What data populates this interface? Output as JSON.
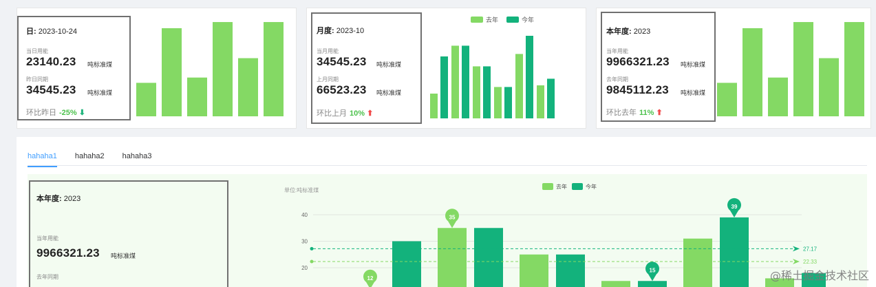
{
  "cards": [
    {
      "title_label": "日:",
      "title_value": "2023-10-24",
      "cur_label": "当日用能",
      "cur_value": "23140.23",
      "cur_unit": "吨标准煤",
      "prev_label": "昨日同期",
      "prev_value": "34545.23",
      "prev_unit": "吨标准煤",
      "compare_label": "环比昨日",
      "compare_value": "-25%",
      "arrow": "⬇",
      "bars": [
        0.38,
        1.0,
        0.44,
        1.07,
        0.66,
        1.07
      ]
    },
    {
      "title_label": "月度:",
      "title_value": "2023-10",
      "cur_label": "当月用能",
      "cur_value": "34545.23",
      "cur_unit": "吨标准煤",
      "prev_label": "上月同期",
      "prev_value": "66523.23",
      "prev_unit": "吨标准煤",
      "compare_label": "环比上月",
      "compare_value": "10%",
      "arrow": "⬆",
      "legend_last": "去年",
      "legend_this": "今年",
      "groups": [
        [
          0.3,
          0.75
        ],
        [
          0.88,
          0.88
        ],
        [
          0.63,
          0.63
        ],
        [
          0.38,
          0.38
        ],
        [
          0.78,
          1.0
        ],
        [
          0.4,
          0.48
        ]
      ]
    },
    {
      "title_label": "本年度:",
      "title_value": "2023",
      "cur_label": "当年用能",
      "cur_value": "9966321.23",
      "cur_unit": "吨标准煤",
      "prev_label": "去年同期",
      "prev_value": "9845112.23",
      "prev_unit": "吨标准煤",
      "compare_label": "环比去年",
      "compare_value": "11%",
      "arrow": "⬆",
      "bars": [
        0.38,
        1.0,
        0.44,
        1.07,
        0.66,
        1.07
      ]
    }
  ],
  "tabs": [
    "hahaha1",
    "hahaha2",
    "hahaha3"
  ],
  "detail": {
    "title_label": "本年度:",
    "title_value": "2023",
    "cur_label": "当年用能",
    "cur_value": "9966321.23",
    "cur_unit": "吨标准煤",
    "prev_label": "去年同期"
  },
  "chart_data": {
    "type": "bar",
    "ylabel": "单位:吨标准煤",
    "yticks": [
      20,
      30,
      40
    ],
    "ylim": [
      0,
      45
    ],
    "series": [
      {
        "name": "去年",
        "color": "#84d964",
        "values": [
          12,
          35,
          25,
          15,
          31,
          16
        ]
      },
      {
        "name": "今年",
        "color": "#13b27c",
        "values": [
          30,
          35,
          25,
          15,
          39,
          18
        ]
      }
    ],
    "markers": [
      {
        "series": 0,
        "index": 0,
        "label": "12"
      },
      {
        "series": 0,
        "index": 1,
        "label": "35"
      },
      {
        "series": 1,
        "index": 3,
        "label": "15"
      },
      {
        "series": 1,
        "index": 4,
        "label": "39"
      }
    ],
    "avg_lines": [
      {
        "value": 27.17,
        "label": "27.17",
        "color": "#13b27c"
      },
      {
        "value": 22.33,
        "label": "22.33",
        "color": "#84d964"
      }
    ]
  },
  "watermark": "@稀土掘金技术社区",
  "colors": {
    "last_year": "#84d964",
    "this_year": "#13b27c",
    "tab_active": "#409eff"
  }
}
